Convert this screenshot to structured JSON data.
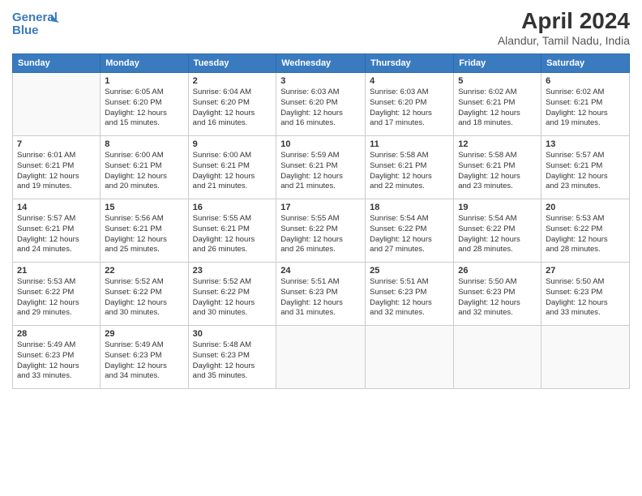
{
  "header": {
    "logo_line1": "General",
    "logo_line2": "Blue",
    "month": "April 2024",
    "location": "Alandur, Tamil Nadu, India"
  },
  "days_of_week": [
    "Sunday",
    "Monday",
    "Tuesday",
    "Wednesday",
    "Thursday",
    "Friday",
    "Saturday"
  ],
  "weeks": [
    [
      {
        "day": "",
        "info": ""
      },
      {
        "day": "1",
        "info": "Sunrise: 6:05 AM\nSunset: 6:20 PM\nDaylight: 12 hours\nand 15 minutes."
      },
      {
        "day": "2",
        "info": "Sunrise: 6:04 AM\nSunset: 6:20 PM\nDaylight: 12 hours\nand 16 minutes."
      },
      {
        "day": "3",
        "info": "Sunrise: 6:03 AM\nSunset: 6:20 PM\nDaylight: 12 hours\nand 16 minutes."
      },
      {
        "day": "4",
        "info": "Sunrise: 6:03 AM\nSunset: 6:20 PM\nDaylight: 12 hours\nand 17 minutes."
      },
      {
        "day": "5",
        "info": "Sunrise: 6:02 AM\nSunset: 6:21 PM\nDaylight: 12 hours\nand 18 minutes."
      },
      {
        "day": "6",
        "info": "Sunrise: 6:02 AM\nSunset: 6:21 PM\nDaylight: 12 hours\nand 19 minutes."
      }
    ],
    [
      {
        "day": "7",
        "info": "Sunrise: 6:01 AM\nSunset: 6:21 PM\nDaylight: 12 hours\nand 19 minutes."
      },
      {
        "day": "8",
        "info": "Sunrise: 6:00 AM\nSunset: 6:21 PM\nDaylight: 12 hours\nand 20 minutes."
      },
      {
        "day": "9",
        "info": "Sunrise: 6:00 AM\nSunset: 6:21 PM\nDaylight: 12 hours\nand 21 minutes."
      },
      {
        "day": "10",
        "info": "Sunrise: 5:59 AM\nSunset: 6:21 PM\nDaylight: 12 hours\nand 21 minutes."
      },
      {
        "day": "11",
        "info": "Sunrise: 5:58 AM\nSunset: 6:21 PM\nDaylight: 12 hours\nand 22 minutes."
      },
      {
        "day": "12",
        "info": "Sunrise: 5:58 AM\nSunset: 6:21 PM\nDaylight: 12 hours\nand 23 minutes."
      },
      {
        "day": "13",
        "info": "Sunrise: 5:57 AM\nSunset: 6:21 PM\nDaylight: 12 hours\nand 23 minutes."
      }
    ],
    [
      {
        "day": "14",
        "info": "Sunrise: 5:57 AM\nSunset: 6:21 PM\nDaylight: 12 hours\nand 24 minutes."
      },
      {
        "day": "15",
        "info": "Sunrise: 5:56 AM\nSunset: 6:21 PM\nDaylight: 12 hours\nand 25 minutes."
      },
      {
        "day": "16",
        "info": "Sunrise: 5:55 AM\nSunset: 6:21 PM\nDaylight: 12 hours\nand 26 minutes."
      },
      {
        "day": "17",
        "info": "Sunrise: 5:55 AM\nSunset: 6:22 PM\nDaylight: 12 hours\nand 26 minutes."
      },
      {
        "day": "18",
        "info": "Sunrise: 5:54 AM\nSunset: 6:22 PM\nDaylight: 12 hours\nand 27 minutes."
      },
      {
        "day": "19",
        "info": "Sunrise: 5:54 AM\nSunset: 6:22 PM\nDaylight: 12 hours\nand 28 minutes."
      },
      {
        "day": "20",
        "info": "Sunrise: 5:53 AM\nSunset: 6:22 PM\nDaylight: 12 hours\nand 28 minutes."
      }
    ],
    [
      {
        "day": "21",
        "info": "Sunrise: 5:53 AM\nSunset: 6:22 PM\nDaylight: 12 hours\nand 29 minutes."
      },
      {
        "day": "22",
        "info": "Sunrise: 5:52 AM\nSunset: 6:22 PM\nDaylight: 12 hours\nand 30 minutes."
      },
      {
        "day": "23",
        "info": "Sunrise: 5:52 AM\nSunset: 6:22 PM\nDaylight: 12 hours\nand 30 minutes."
      },
      {
        "day": "24",
        "info": "Sunrise: 5:51 AM\nSunset: 6:23 PM\nDaylight: 12 hours\nand 31 minutes."
      },
      {
        "day": "25",
        "info": "Sunrise: 5:51 AM\nSunset: 6:23 PM\nDaylight: 12 hours\nand 32 minutes."
      },
      {
        "day": "26",
        "info": "Sunrise: 5:50 AM\nSunset: 6:23 PM\nDaylight: 12 hours\nand 32 minutes."
      },
      {
        "day": "27",
        "info": "Sunrise: 5:50 AM\nSunset: 6:23 PM\nDaylight: 12 hours\nand 33 minutes."
      }
    ],
    [
      {
        "day": "28",
        "info": "Sunrise: 5:49 AM\nSunset: 6:23 PM\nDaylight: 12 hours\nand 33 minutes."
      },
      {
        "day": "29",
        "info": "Sunrise: 5:49 AM\nSunset: 6:23 PM\nDaylight: 12 hours\nand 34 minutes."
      },
      {
        "day": "30",
        "info": "Sunrise: 5:48 AM\nSunset: 6:23 PM\nDaylight: 12 hours\nand 35 minutes."
      },
      {
        "day": "",
        "info": ""
      },
      {
        "day": "",
        "info": ""
      },
      {
        "day": "",
        "info": ""
      },
      {
        "day": "",
        "info": ""
      }
    ]
  ]
}
